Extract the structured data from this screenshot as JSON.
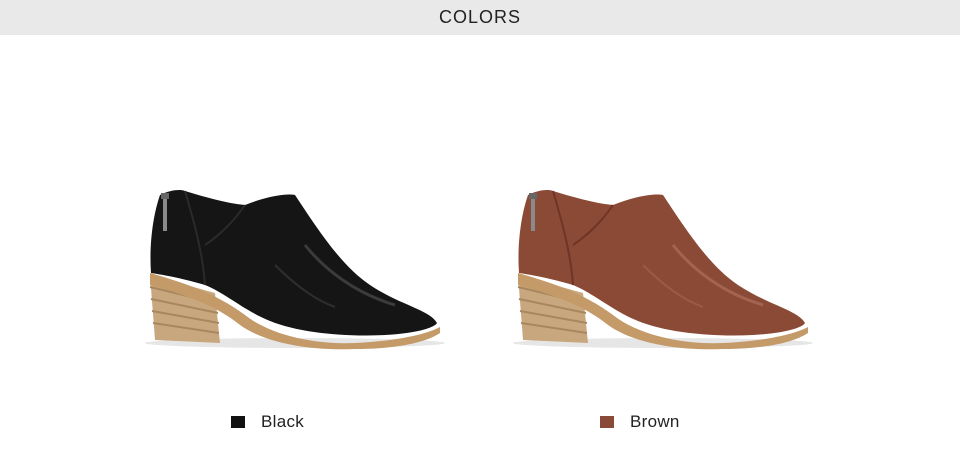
{
  "header": {
    "title": "COLORS"
  },
  "variants": [
    {
      "label": "Black",
      "color": "#111111",
      "upper": "#151515",
      "upper_shade": "#2a2a2a",
      "highlight": "#555555"
    },
    {
      "label": "Brown",
      "color": "#8a4a38",
      "upper": "#8b4a36",
      "upper_shade": "#6e3526",
      "highlight": "#b27560"
    }
  ],
  "colors": {
    "header_bg": "#e9e9e9",
    "heel_wood": "#c9a77e",
    "sole": "#c49a68"
  }
}
